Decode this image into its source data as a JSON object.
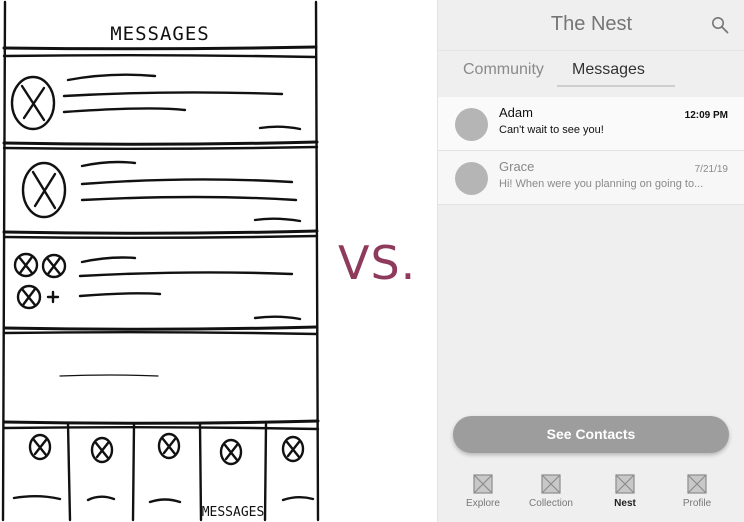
{
  "sketch": {
    "title": "MESSAGES",
    "tab_label": "MESSAGES"
  },
  "vs_text": "VS.",
  "app": {
    "title": "The Nest",
    "search_icon": "search-icon",
    "tabs": [
      {
        "label": "Community",
        "active": false
      },
      {
        "label": "Messages",
        "active": true
      }
    ],
    "messages": [
      {
        "name": "Adam",
        "preview": "Can't wait to see you!",
        "time": "12:09 PM",
        "unread": true
      },
      {
        "name": "Grace",
        "preview": "Hi! When were you planning on going to...",
        "time": "7/21/19",
        "unread": false
      }
    ],
    "cta_label": "See Contacts",
    "nav": [
      {
        "label": "Explore",
        "icon": "image-placeholder-icon",
        "active": false
      },
      {
        "label": "Collection",
        "icon": "image-placeholder-icon",
        "active": false
      },
      {
        "label": "Nest",
        "icon": "image-placeholder-icon",
        "active": true
      },
      {
        "label": "Profile",
        "icon": "image-placeholder-icon",
        "active": false
      }
    ],
    "colors": {
      "accent_vs": "#8e3a5d",
      "button": "#9d9d9d",
      "avatar": "#b5b5b5"
    }
  }
}
